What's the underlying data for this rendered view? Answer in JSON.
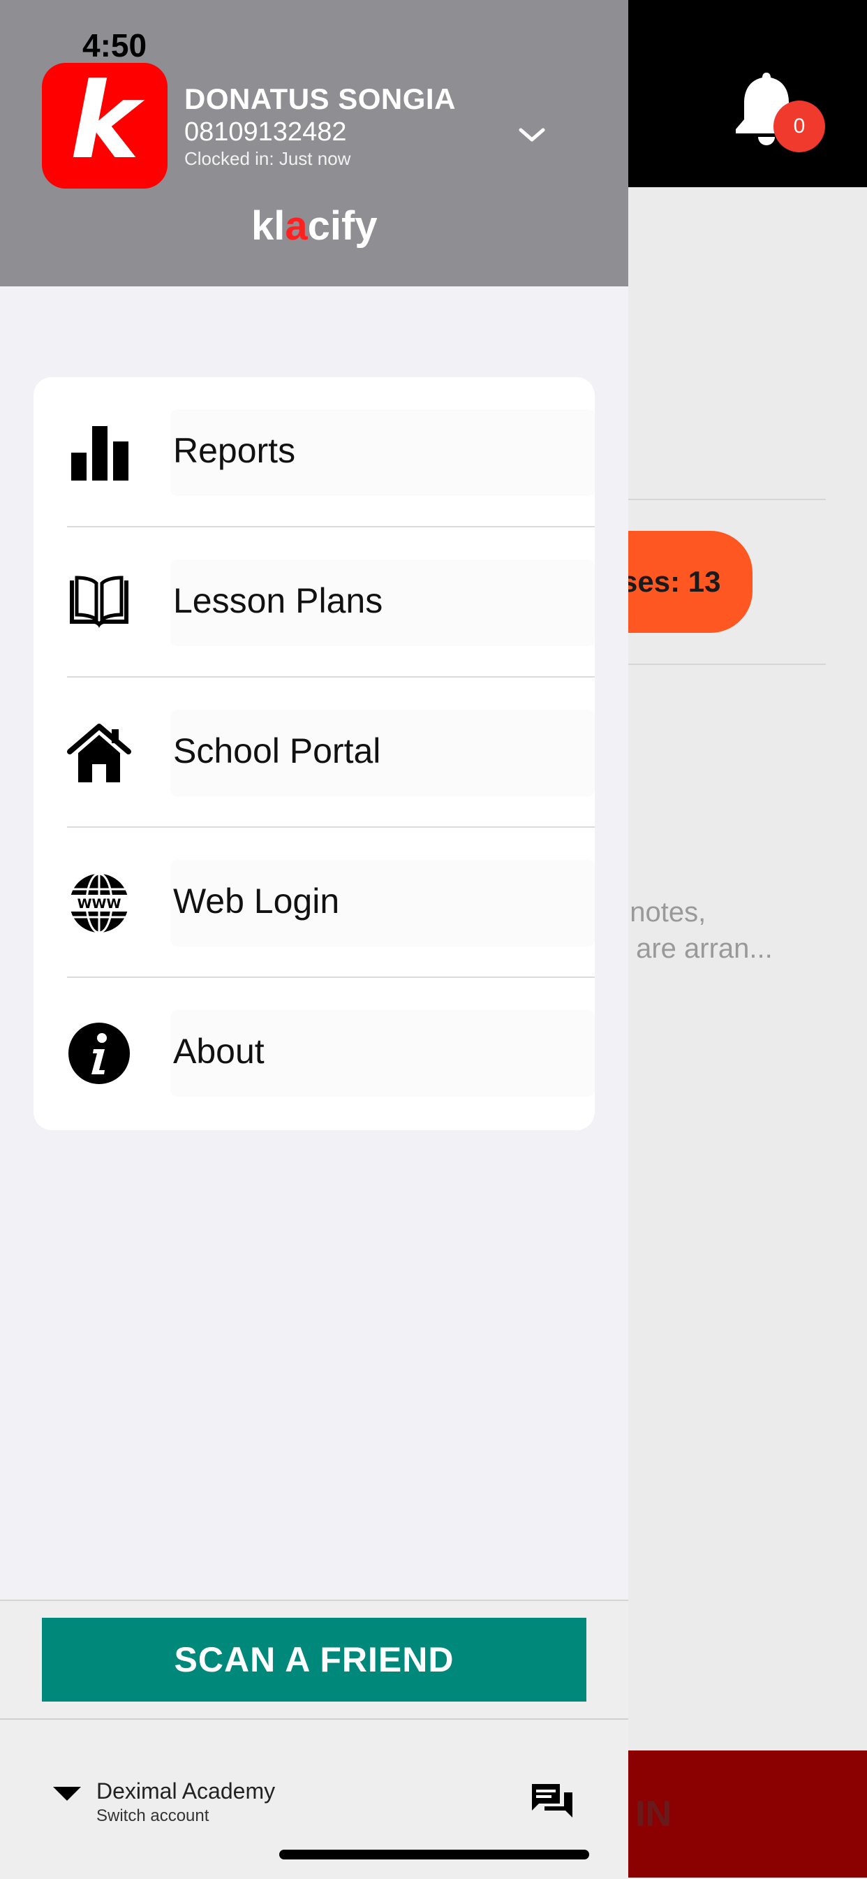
{
  "status_bar": {
    "time": "4:50"
  },
  "background_app": {
    "notification_count": "0",
    "pill_text": "ses: 13",
    "description_line1": ", notes,",
    "description_line2": "s are arran...",
    "bottom_button_text": "IN",
    "colors": {
      "topbar": "#000000",
      "pill": "#ff5722",
      "badge": "#f03a2e",
      "bottom_button": "#8b0000"
    }
  },
  "drawer": {
    "header": {
      "logo_letter": "k",
      "user_name": "DONATUS SONGIA",
      "phone": "08109132482",
      "clocked_in": "Clocked in: Just now",
      "brand_pre": "kl",
      "brand_accent": "a",
      "brand_post": "cify",
      "colors": {
        "background": "#8e8e93",
        "logo": "#ff0000"
      }
    },
    "menu": [
      {
        "label": "Reports",
        "icon": "bar-chart-icon"
      },
      {
        "label": "Lesson Plans",
        "icon": "book-icon"
      },
      {
        "label": "School Portal",
        "icon": "home-icon"
      },
      {
        "label": "Web Login",
        "icon": "globe-www-icon"
      },
      {
        "label": "About",
        "icon": "info-icon"
      }
    ],
    "footer": {
      "scan_button": "SCAN A FRIEND",
      "account_name": "Deximal Academy",
      "switch_account": "Switch account",
      "colors": {
        "scan_button": "#00897b"
      }
    }
  }
}
